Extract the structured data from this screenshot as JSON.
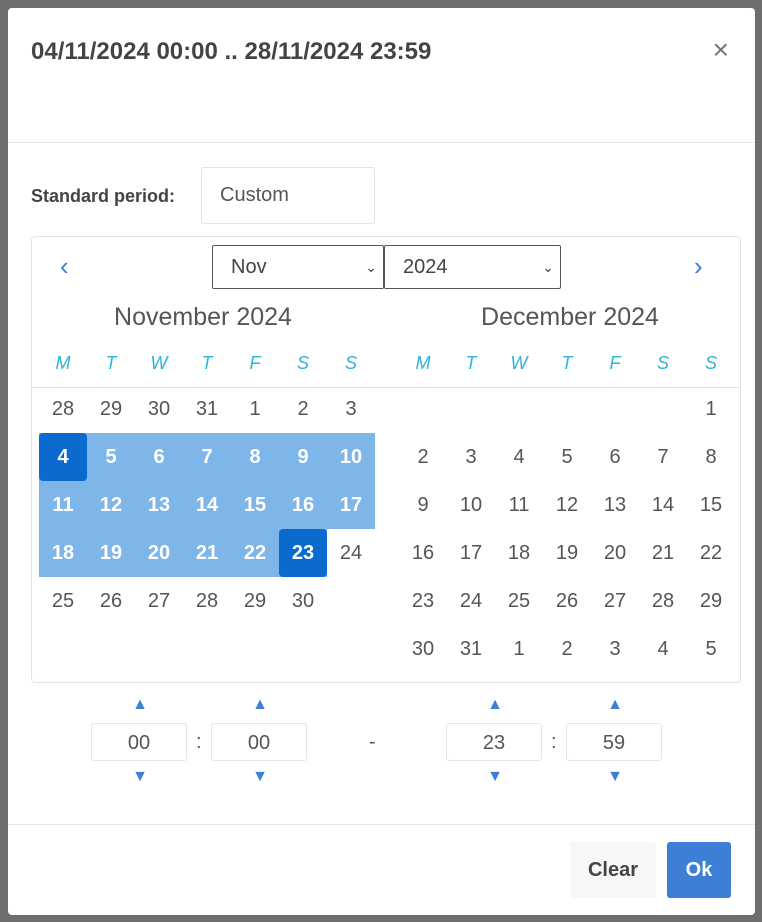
{
  "header": {
    "title": "04/11/2024 00:00 .. 28/11/2024 23:59",
    "close": "×"
  },
  "standard_period": {
    "label": "Standard period:",
    "value": "Custom"
  },
  "calendar": {
    "prev": "‹",
    "next": "›",
    "month_select": "Nov",
    "year_select": "2024",
    "weekdays": [
      "M",
      "T",
      "W",
      "T",
      "F",
      "S",
      "S"
    ],
    "months": [
      {
        "title": "November 2024",
        "days": [
          [
            28,
            29,
            30,
            31,
            1,
            2,
            3
          ],
          [
            4,
            5,
            6,
            7,
            8,
            9,
            10
          ],
          [
            11,
            12,
            13,
            14,
            15,
            16,
            17
          ],
          [
            18,
            19,
            20,
            21,
            22,
            23,
            24
          ],
          [
            25,
            26,
            27,
            28,
            29,
            30,
            null
          ]
        ],
        "range": [
          4,
          23
        ]
      },
      {
        "title": "December 2024",
        "days": [
          [
            null,
            null,
            null,
            null,
            null,
            null,
            1
          ],
          [
            2,
            3,
            4,
            5,
            6,
            7,
            8
          ],
          [
            9,
            10,
            11,
            12,
            13,
            14,
            15
          ],
          [
            16,
            17,
            18,
            19,
            20,
            21,
            22
          ],
          [
            23,
            24,
            25,
            26,
            27,
            28,
            29
          ],
          [
            30,
            31,
            1,
            2,
            3,
            4,
            5
          ]
        ]
      }
    ]
  },
  "colors": {
    "range": "#7fb6ea",
    "range_edge": "#0a6acd",
    "accent": "#3d7fd6",
    "weekday": "#2bb5d8"
  },
  "time": {
    "start_hour": "00",
    "start_minute": "00",
    "separator": "-",
    "end_hour": "23",
    "end_minute": "59",
    "colon": ":"
  },
  "footer": {
    "clear": "Clear",
    "ok": "Ok"
  }
}
